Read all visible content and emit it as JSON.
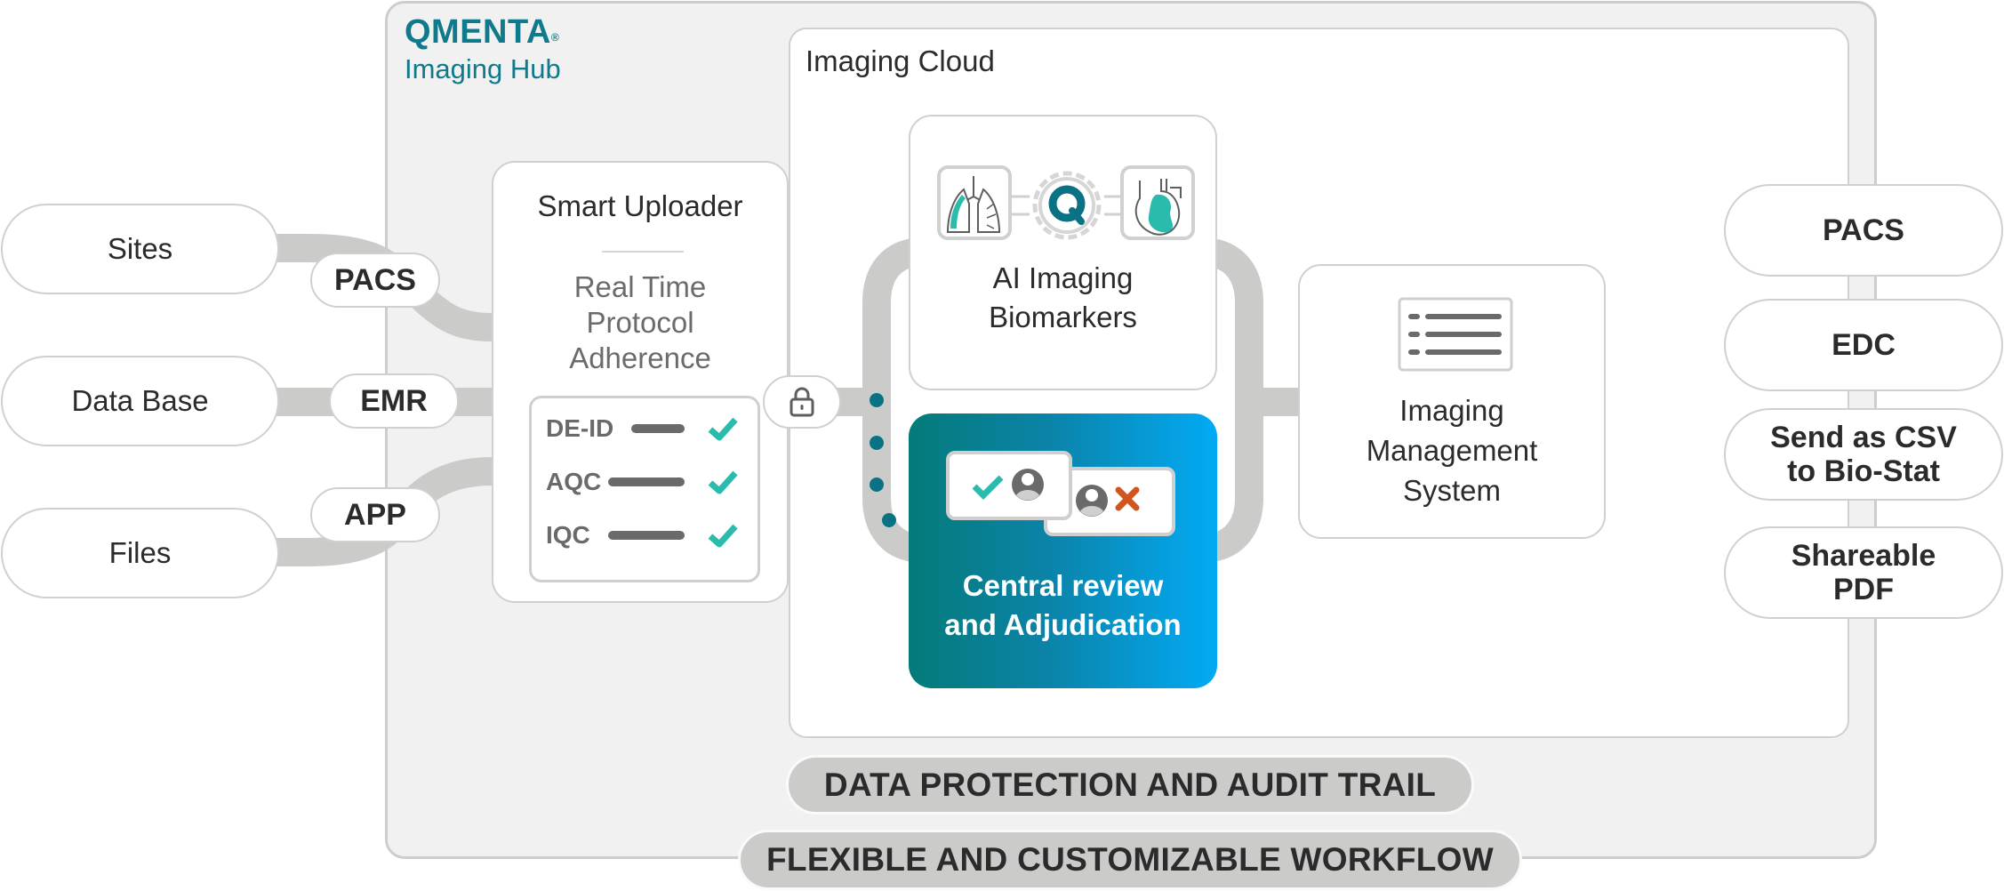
{
  "brand": {
    "name": "QMENTA",
    "registered_mark": "®",
    "product": "Imaging Hub"
  },
  "colors": {
    "brand_teal": "#0f7a8c",
    "check_teal": "#2bbbad",
    "reject_orange": "#d2541f",
    "connector_gray": "#cbcbca",
    "gradient_start": "#047b79",
    "gradient_end": "#02aaf4"
  },
  "sources": [
    {
      "label": "Sites"
    },
    {
      "label": "Data Base"
    },
    {
      "label": "Files"
    }
  ],
  "source_channels": [
    {
      "label": "PACS"
    },
    {
      "label": "EMR"
    },
    {
      "label": "APP"
    }
  ],
  "smart_uploader": {
    "title": "Smart Uploader",
    "subtitle_lines": [
      "Real Time",
      "Protocol",
      "Adherence"
    ],
    "checks": [
      {
        "label": "DE-ID",
        "status": "passed",
        "icon": "check-icon"
      },
      {
        "label": "AQC",
        "status": "passed",
        "icon": "check-icon"
      },
      {
        "label": "IQC",
        "status": "passed",
        "icon": "check-icon"
      }
    ]
  },
  "secure_link": {
    "icon": "lock-icon"
  },
  "imaging_cloud": {
    "title": "Imaging Cloud",
    "ai_biomarkers": {
      "title_lines": [
        "AI Imaging",
        "Biomarkers"
      ],
      "icons": [
        "lungs-icon",
        "gear-q-icon",
        "heart-icon"
      ]
    },
    "central_review": {
      "title_lines": [
        "Central review",
        "and Adjudication"
      ],
      "icons": [
        "approve-check-icon",
        "reviewer-avatar-icon",
        "reviewer-avatar-icon",
        "reject-x-icon"
      ]
    }
  },
  "ims": {
    "title_lines": [
      "Imaging",
      "Management",
      "System"
    ],
    "icon": "list-document-icon"
  },
  "outputs": [
    {
      "lines": [
        "PACS"
      ]
    },
    {
      "lines": [
        "EDC"
      ]
    },
    {
      "lines": [
        "Send as CSV",
        "to Bio-Stat"
      ]
    },
    {
      "lines": [
        "Shareable",
        "PDF"
      ]
    }
  ],
  "banners": [
    {
      "label": "DATA PROTECTION AND AUDIT TRAIL"
    },
    {
      "label": "FLEXIBLE AND CUSTOMIZABLE WORKFLOW"
    }
  ]
}
